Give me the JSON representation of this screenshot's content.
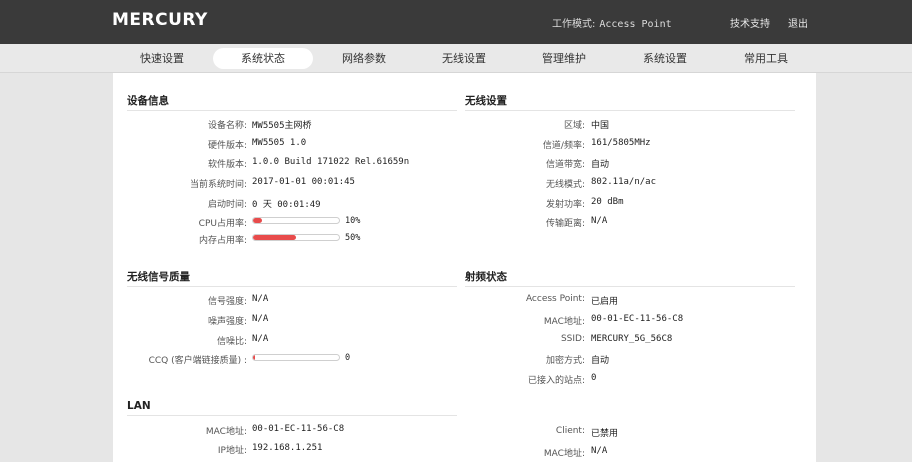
{
  "header": {
    "logo": "MERCURY",
    "mode_label": "工作模式:",
    "mode_value": "Access Point",
    "support": "技术支持",
    "logout": "退出"
  },
  "nav": {
    "tabs": [
      "快速设置",
      "系统状态",
      "网络参数",
      "无线设置",
      "管理维护",
      "系统设置",
      "常用工具"
    ],
    "active_index": 1
  },
  "device_info": {
    "title": "设备信息",
    "rows": [
      {
        "label": "设备名称:",
        "value": "MW5505主网桥"
      },
      {
        "label": "硬件版本:",
        "value": "MW5505 1.0"
      },
      {
        "label": "软件版本:",
        "value": "1.0.0 Build 171022 Rel.61659n"
      },
      {
        "label": "当前系统时间:",
        "value": "2017-01-01 00:01:45"
      },
      {
        "label": "启动时间:",
        "value": "0 天 00:01:49"
      }
    ],
    "cpu": {
      "label": "CPU占用率:",
      "percent_text": "10%",
      "fraction": 0.1
    },
    "mem": {
      "label": "内存占用率:",
      "percent_text": "50%",
      "fraction": 0.5
    }
  },
  "wireless_settings": {
    "title": "无线设置",
    "rows": [
      {
        "label": "区域:",
        "value": "中国"
      },
      {
        "label": "信道/频率:",
        "value": "161/5805MHz"
      },
      {
        "label": "信道带宽:",
        "value": "自动"
      },
      {
        "label": "无线模式:",
        "value": "802.11a/n/ac"
      },
      {
        "label": "发射功率:",
        "value": "20 dBm"
      },
      {
        "label": "传输距离:",
        "value": "N/A"
      }
    ]
  },
  "signal_quality": {
    "title": "无线信号质量",
    "rows": [
      {
        "label": "信号强度:",
        "value": "N/A"
      },
      {
        "label": "噪声强度:",
        "value": "N/A"
      },
      {
        "label": "信噪比:",
        "value": "N/A"
      }
    ],
    "ccq": {
      "label": "CCQ (客户端链接质量) :",
      "value_text": "0",
      "fraction": 0.0
    }
  },
  "rf_status": {
    "title": "射频状态",
    "rows": [
      {
        "label": "Access Point:",
        "value": "已启用"
      },
      {
        "label": "MAC地址:",
        "value": "00-01-EC-11-56-C8"
      },
      {
        "label": "SSID:",
        "value": "MERCURY_5G_56C8"
      },
      {
        "label": "加密方式:",
        "value": "自动"
      },
      {
        "label": "已接入的站点:",
        "value": "0"
      },
      {
        "label": "Client:",
        "value": "已禁用"
      },
      {
        "label": "MAC地址:",
        "value": "N/A"
      }
    ]
  },
  "lan": {
    "title": "LAN",
    "rows": [
      {
        "label": "MAC地址:",
        "value": "00-01-EC-11-56-C8"
      },
      {
        "label": "IP地址:",
        "value": "192.168.1.251"
      }
    ]
  }
}
